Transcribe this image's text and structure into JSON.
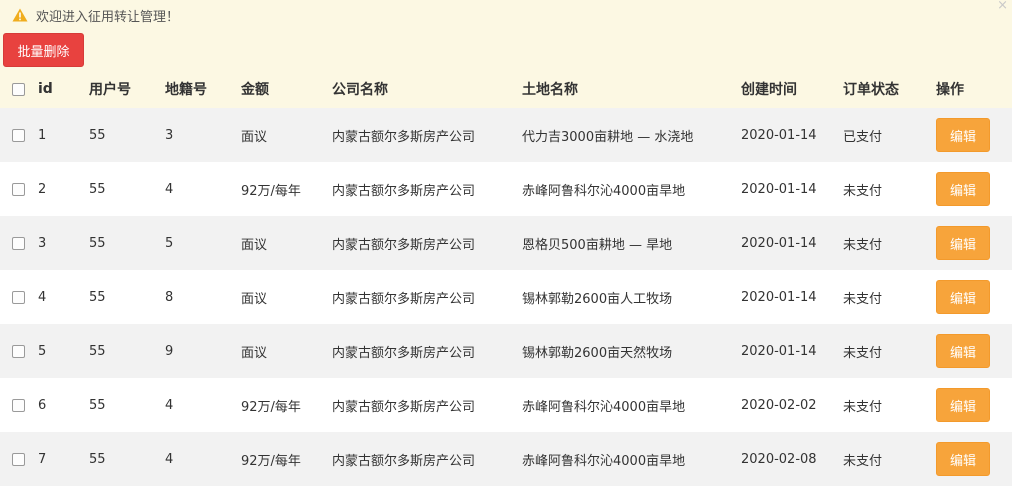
{
  "alert": {
    "message": "欢迎进入征用转让管理！",
    "close": "×",
    "icon": "warning-icon"
  },
  "toolbar": {
    "batch_delete_label": "批量删除"
  },
  "table": {
    "headers": {
      "id": "id",
      "user_no": "用户号",
      "land_no": "地籍号",
      "amount": "金额",
      "company": "公司名称",
      "land_name": "土地名称",
      "created": "创建时间",
      "status": "订单状态",
      "actions": "操作"
    },
    "edit_label": "编辑",
    "rows": [
      {
        "id": "1",
        "user_no": "55",
        "land_no": "3",
        "amount": "面议",
        "company": "内蒙古额尔多斯房产公司",
        "land_name": "代力吉3000亩耕地 — 水浇地",
        "created": "2020-01-14",
        "status": "已支付"
      },
      {
        "id": "2",
        "user_no": "55",
        "land_no": "4",
        "amount": "92万/每年",
        "company": "内蒙古额尔多斯房产公司",
        "land_name": "赤峰阿鲁科尔沁4000亩旱地",
        "created": "2020-01-14",
        "status": "未支付"
      },
      {
        "id": "3",
        "user_no": "55",
        "land_no": "5",
        "amount": "面议",
        "company": "内蒙古额尔多斯房产公司",
        "land_name": "恩格贝500亩耕地 — 旱地",
        "created": "2020-01-14",
        "status": "未支付"
      },
      {
        "id": "4",
        "user_no": "55",
        "land_no": "8",
        "amount": "面议",
        "company": "内蒙古额尔多斯房产公司",
        "land_name": "锡林郭勒2600亩人工牧场",
        "created": "2020-01-14",
        "status": "未支付"
      },
      {
        "id": "5",
        "user_no": "55",
        "land_no": "9",
        "amount": "面议",
        "company": "内蒙古额尔多斯房产公司",
        "land_name": "锡林郭勒2600亩天然牧场",
        "created": "2020-01-14",
        "status": "未支付"
      },
      {
        "id": "6",
        "user_no": "55",
        "land_no": "4",
        "amount": "92万/每年",
        "company": "内蒙古额尔多斯房产公司",
        "land_name": "赤峰阿鲁科尔沁4000亩旱地",
        "created": "2020-02-02",
        "status": "未支付"
      },
      {
        "id": "7",
        "user_no": "55",
        "land_no": "4",
        "amount": "92万/每年",
        "company": "内蒙古额尔多斯房产公司",
        "land_name": "赤峰阿鲁科尔沁4000亩旱地",
        "created": "2020-02-08",
        "status": "未支付"
      }
    ]
  },
  "colors": {
    "alert_bg": "#fcf8e3",
    "danger": "#e8423f",
    "warning": "#f7a43b",
    "row_stripe": "#f2f2f2"
  }
}
